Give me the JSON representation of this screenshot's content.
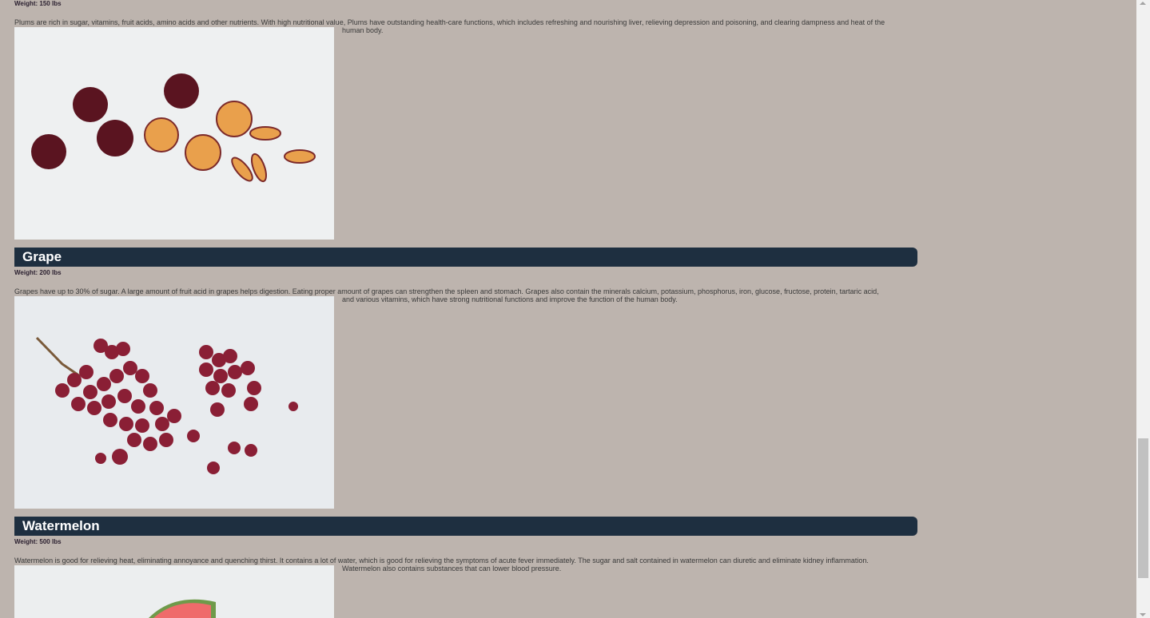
{
  "fruits": [
    {
      "name": "",
      "weight": "Weight: 150 lbs",
      "description_line1": "Plums are rich in sugar, vitamins, fruit acids, amino acids and other nutrients. With high nutritional value, Plums have outstanding health-care functions, which includes refreshing and nourishing liver, relieving depression and poisoning, and clearing dampness and heat of the",
      "description_line2": "human body.",
      "image_icon": "plums-photo"
    },
    {
      "name": "Grape",
      "weight": "Weight: 200 lbs",
      "description_line1": "Grapes have up to 30% of sugar. A large amount of fruit acid in grapes helps digestion. Eating proper amount of grapes can strengthen the spleen and stomach. Grapes also contain the minerals calcium, potassium, phosphorus, iron, glucose, fructose, protein, tartaric acid,",
      "description_line2": "and various vitamins, which have strong nutritional functions and improve the function of the human body.",
      "image_icon": "grapes-photo"
    },
    {
      "name": "Watermelon",
      "weight": "Weight: 500 lbs",
      "description_line1": "Watermelon is good for relieving heat, eliminating annoyance and quenching thirst. It contains a lot of water, which is good for relieving the symptoms of acute fever immediately. The sugar and salt contained in watermelon can diuretic and eliminate kidney inflammation.",
      "description_line2": "Watermelon also contains substances that can lower blood pressure.",
      "image_icon": "watermelon-photo"
    }
  ],
  "colors": {
    "page_background": "#bdb4ae",
    "header_bar": "#1e2f40",
    "header_text": "#ffffff"
  }
}
